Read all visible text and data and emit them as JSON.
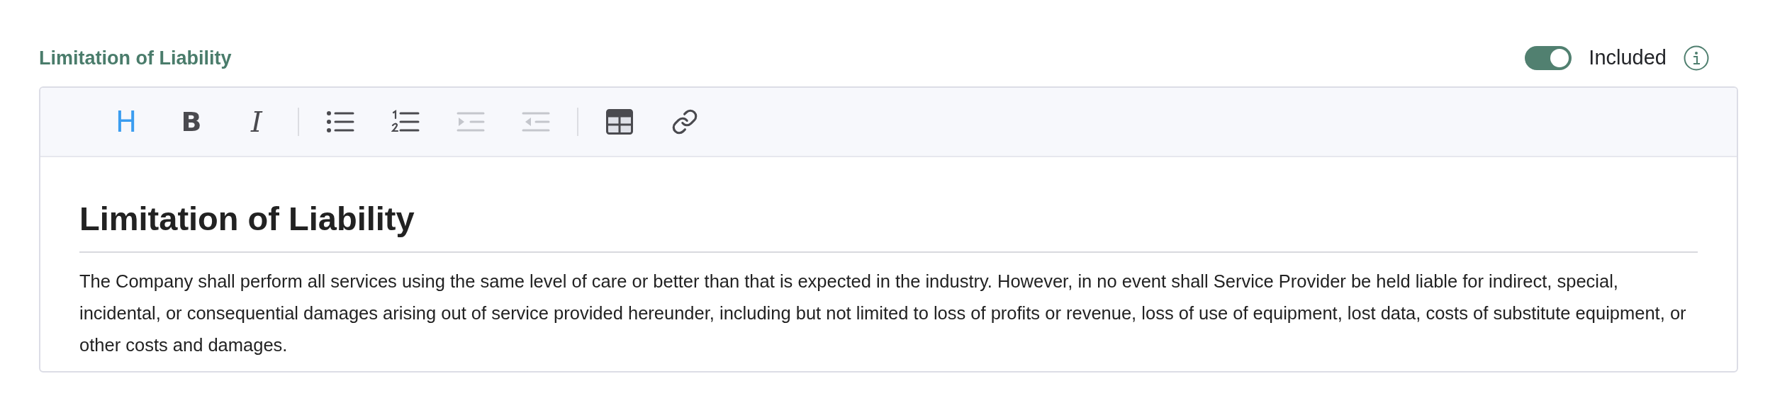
{
  "section": {
    "title": "Limitation of Liability",
    "toggle": {
      "label": "Included",
      "on": true
    }
  },
  "toolbar": {
    "groups": [
      [
        {
          "kind": "heading",
          "label": "H",
          "selected": true,
          "disabled": false
        },
        {
          "kind": "bold",
          "label": "B",
          "selected": false,
          "disabled": false
        },
        {
          "kind": "italic",
          "label": "I",
          "selected": false,
          "disabled": false
        }
      ],
      [
        {
          "kind": "bullet_list",
          "selected": false,
          "disabled": false
        },
        {
          "kind": "ordered_list",
          "selected": false,
          "disabled": false
        },
        {
          "kind": "indent",
          "selected": false,
          "disabled": true
        },
        {
          "kind": "outdent",
          "selected": false,
          "disabled": true
        }
      ],
      [
        {
          "kind": "table",
          "selected": false,
          "disabled": false
        },
        {
          "kind": "link",
          "selected": false,
          "disabled": false
        }
      ]
    ]
  },
  "content": {
    "heading": "Limitation of Liability",
    "paragraph": "The Company shall perform all services using the same level of care or better than that is expected in the industry. However, in no event shall Service Provider be held liable for indirect, special, incidental, or consequential damages arising out of service provided hereunder, including but not limited to loss of profits or revenue, loss of use of equipment, lost data, costs of substitute equipment, or other costs and damages."
  }
}
